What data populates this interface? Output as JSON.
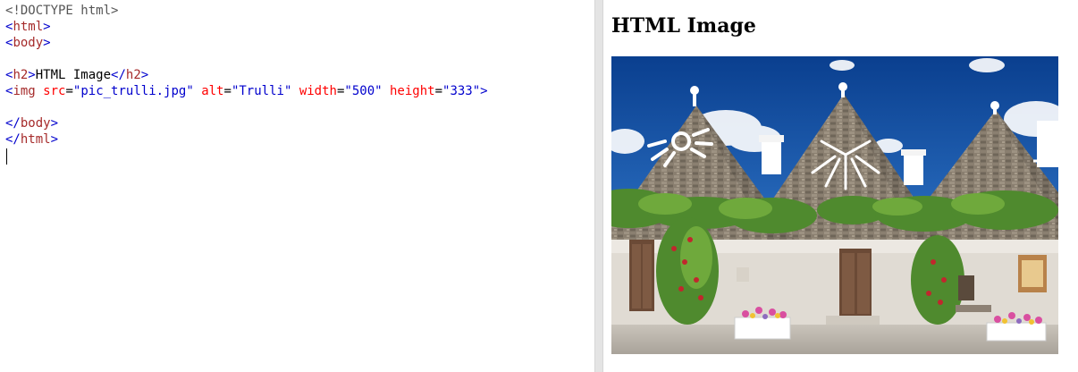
{
  "editor": {
    "lines": [
      [
        {
          "t": "doctype",
          "v": "<!DOCTYPE html>"
        }
      ],
      [
        {
          "t": "bracket",
          "v": "<"
        },
        {
          "t": "tag",
          "v": "html"
        },
        {
          "t": "bracket",
          "v": ">"
        }
      ],
      [
        {
          "t": "bracket",
          "v": "<"
        },
        {
          "t": "tag",
          "v": "body"
        },
        {
          "t": "bracket",
          "v": ">"
        }
      ],
      [],
      [
        {
          "t": "bracket",
          "v": "<"
        },
        {
          "t": "tag",
          "v": "h2"
        },
        {
          "t": "bracket",
          "v": ">"
        },
        {
          "t": "text",
          "v": "HTML Image"
        },
        {
          "t": "bracket",
          "v": "</"
        },
        {
          "t": "tag",
          "v": "h2"
        },
        {
          "t": "bracket",
          "v": ">"
        }
      ],
      [
        {
          "t": "bracket",
          "v": "<"
        },
        {
          "t": "tag",
          "v": "img"
        },
        {
          "t": "text",
          "v": " "
        },
        {
          "t": "attr",
          "v": "src"
        },
        {
          "t": "eq",
          "v": "="
        },
        {
          "t": "string",
          "v": "\"pic_trulli.jpg\""
        },
        {
          "t": "text",
          "v": " "
        },
        {
          "t": "attr",
          "v": "alt"
        },
        {
          "t": "eq",
          "v": "="
        },
        {
          "t": "string",
          "v": "\"Trulli\""
        },
        {
          "t": "text",
          "v": " "
        },
        {
          "t": "attr",
          "v": "width"
        },
        {
          "t": "eq",
          "v": "="
        },
        {
          "t": "string",
          "v": "\"500\""
        },
        {
          "t": "text",
          "v": " "
        },
        {
          "t": "attr",
          "v": "height"
        },
        {
          "t": "eq",
          "v": "="
        },
        {
          "t": "string",
          "v": "\"333\""
        },
        {
          "t": "bracket",
          "v": ">"
        }
      ],
      [],
      [
        {
          "t": "bracket",
          "v": "</"
        },
        {
          "t": "tag",
          "v": "body"
        },
        {
          "t": "bracket",
          "v": ">"
        }
      ],
      [
        {
          "t": "bracket",
          "v": "</"
        },
        {
          "t": "tag",
          "v": "html"
        },
        {
          "t": "bracket",
          "v": ">"
        }
      ]
    ]
  },
  "preview": {
    "heading": "HTML Image",
    "image": {
      "alt": "Trulli"
    }
  },
  "colors": {
    "doctype": "#555555",
    "bracket": "#0000cd",
    "tag": "#a52a2a",
    "attr": "#ff0000",
    "string": "#0000cd",
    "text": "#000000"
  }
}
